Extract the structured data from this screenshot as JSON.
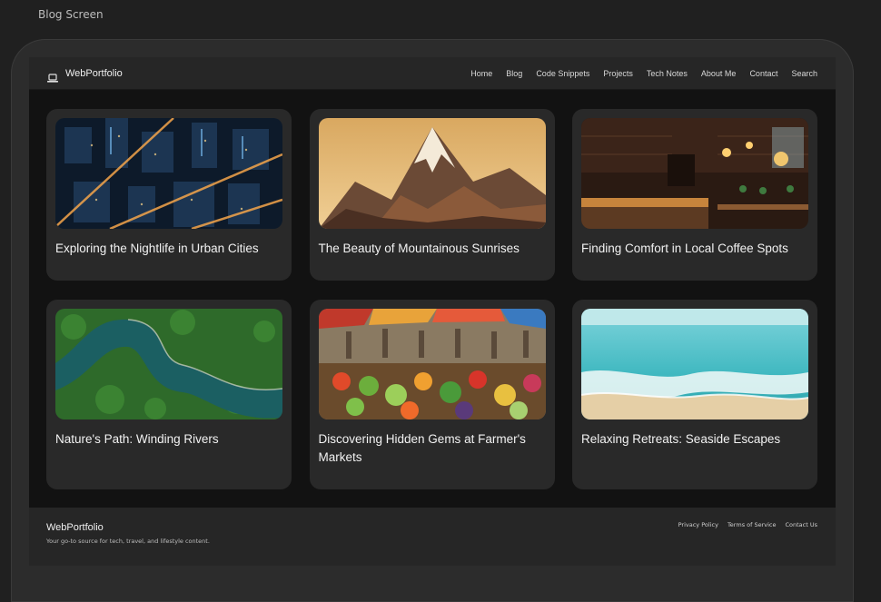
{
  "screen": {
    "label": "Blog Screen"
  },
  "nav": {
    "brand": "WebPortfolio",
    "brand_icon": "laptop-icon",
    "links": [
      "Home",
      "Blog",
      "Code Snippets",
      "Projects",
      "Tech Notes",
      "About Me",
      "Contact",
      "Search"
    ]
  },
  "posts": [
    {
      "title": "Exploring the Nightlife in Urban Cities",
      "image": "night-city-aerial"
    },
    {
      "title": "The Beauty of Mountainous Sunrises",
      "image": "mountain-sunrise"
    },
    {
      "title": "Finding Comfort in Local Coffee Spots",
      "image": "coffee-shop-interior"
    },
    {
      "title": "Nature's Path: Winding Rivers",
      "image": "winding-river-forest"
    },
    {
      "title": "Discovering Hidden Gems at Farmer's Markets",
      "image": "farmers-market"
    },
    {
      "title": "Relaxing Retreats: Seaside Escapes",
      "image": "seaside-beach"
    }
  ],
  "footer": {
    "brand": "WebPortfolio",
    "tagline": "Your go-to source for tech, travel, and lifestyle content.",
    "links": [
      "Privacy Policy",
      "Terms of Service",
      "Contact Us"
    ]
  },
  "colors": {
    "page_bg": "#202020",
    "frame": "#2c2c2c",
    "viewport": "#121212",
    "card": "#292929"
  }
}
